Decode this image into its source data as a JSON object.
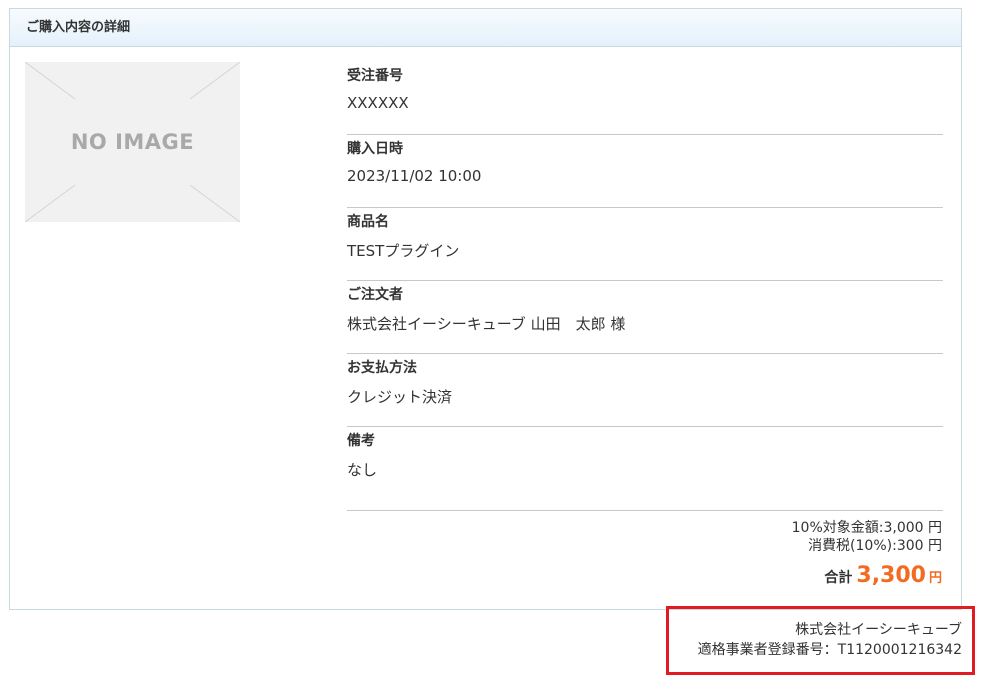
{
  "panel": {
    "title": "ご購入内容の詳細"
  },
  "image": {
    "placeholder_text": "NO IMAGE"
  },
  "details": [
    {
      "label": "受注番号",
      "value": "XXXXXX"
    },
    {
      "label": "購入日時",
      "value": "2023/11/02 10:00"
    },
    {
      "label": "商品名",
      "value": "TESTプラグイン"
    },
    {
      "label": "ご注文者",
      "value": "株式会社イーシーキューブ 山田　太郎 様"
    },
    {
      "label": "お支払方法",
      "value": "クレジット決済"
    },
    {
      "label": "備考",
      "value": "なし"
    }
  ],
  "totals": {
    "taxable_line": "10%対象金額:3,000 円",
    "tax_line": "消費税(10%):300 円",
    "total_label": "合計",
    "total_amount": "3,300",
    "total_unit": "円"
  },
  "issuer": {
    "company": "株式会社イーシーキューブ",
    "registration": "適格事業者登録番号：T1120001216342"
  },
  "colors": {
    "accent": "#f26b21",
    "highlight_border": "#e21b22",
    "panel_border": "#c9d8e1"
  }
}
